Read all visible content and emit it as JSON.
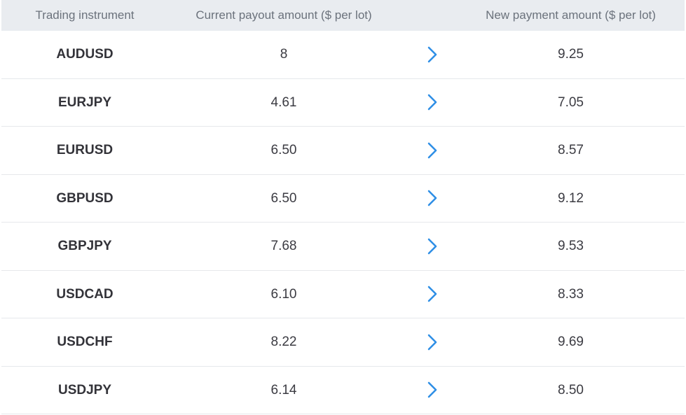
{
  "table": {
    "headers": {
      "instrument": "Trading instrument",
      "current": "Current payout amount ($ per lot)",
      "new": "New payment amount ($ per lot)"
    },
    "arrow_icon": "chevron-right-icon",
    "arrow_color": "#2f8fe6",
    "header_bg": "#e9ecf0",
    "rows": [
      {
        "instrument": "AUDUSD",
        "current": "8",
        "new": "9.25"
      },
      {
        "instrument": "EURJPY",
        "current": "4.61",
        "new": "7.05"
      },
      {
        "instrument": "EURUSD",
        "current": "6.50",
        "new": "8.57"
      },
      {
        "instrument": "GBPUSD",
        "current": "6.50",
        "new": "9.12"
      },
      {
        "instrument": "GBPJPY",
        "current": "7.68",
        "new": "9.53"
      },
      {
        "instrument": "USDCAD",
        "current": "6.10",
        "new": "8.33"
      },
      {
        "instrument": "USDCHF",
        "current": "8.22",
        "new": "9.69"
      },
      {
        "instrument": "USDJPY",
        "current": "6.14",
        "new": "8.50"
      }
    ]
  }
}
